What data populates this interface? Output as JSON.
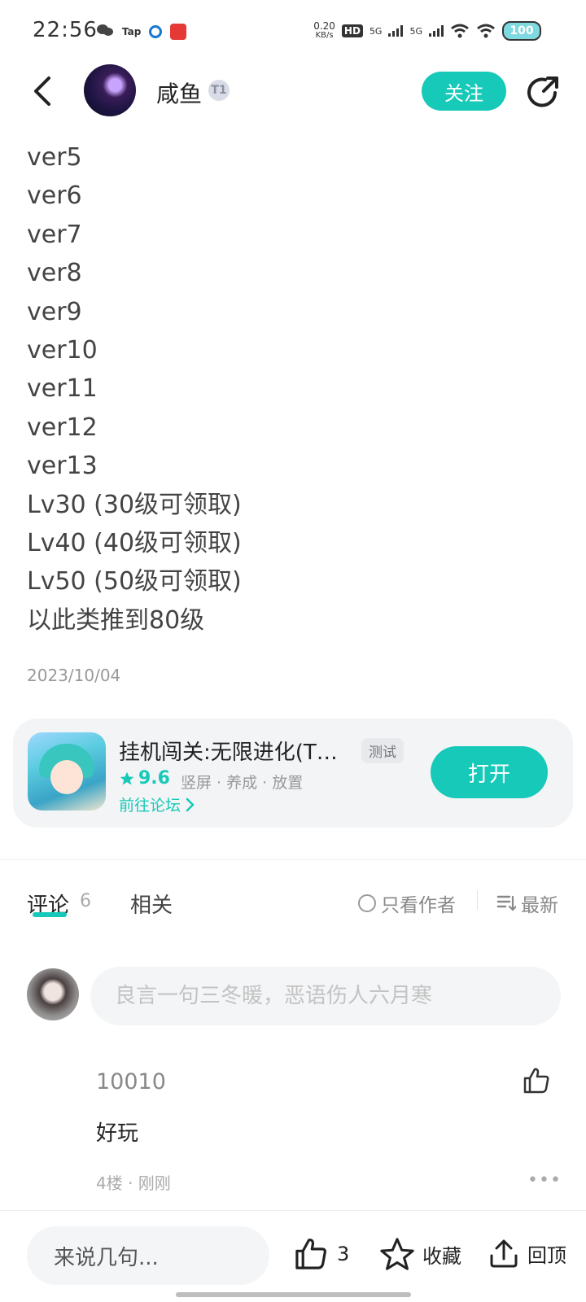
{
  "status_bar": {
    "time": "22:56",
    "left_icons": [
      "wechat-icon",
      "tap-icon",
      "blue-circle-icon",
      "red-app-icon"
    ],
    "tap_label": "Tap",
    "net_speed_value": "0.20",
    "net_speed_unit": "KB/s",
    "hd_label": "HD",
    "signal_labels": [
      "5G",
      "5G"
    ],
    "battery": "100"
  },
  "header": {
    "username": "咸鱼",
    "level_badge": "T1",
    "follow_label": "关注"
  },
  "post": {
    "lines": [
      "ver5",
      "ver6",
      "ver7",
      "ver8",
      "ver9",
      "ver10",
      "ver11",
      "ver12",
      "ver13",
      "Lv30 (30级可领取)",
      "Lv40 (40级可领取)",
      "Lv50 (50级可领取)",
      "以此类推到80级"
    ],
    "date": "2023/10/04"
  },
  "game_card": {
    "title": "挂机闯关:无限进化(T…",
    "tag": "测试",
    "rating": "9.6",
    "tags": "竖屏 · 养成 · 放置",
    "forum_link": "前往论坛",
    "open_label": "打开"
  },
  "tabs": {
    "comments_label": "评论",
    "comments_count": "6",
    "related_label": "相关",
    "only_author_label": "只看作者",
    "sort_label": "最新"
  },
  "comment_input": {
    "placeholder": "良言一句三冬暖，恶语伤人六月寒"
  },
  "comments": [
    {
      "user": "10010",
      "text": "好玩",
      "meta": "4楼 · 刚刚"
    }
  ],
  "bottom_bar": {
    "input_placeholder": "来说几句...",
    "like_count": "3",
    "favorite_label": "收藏",
    "top_label": "回顶"
  }
}
